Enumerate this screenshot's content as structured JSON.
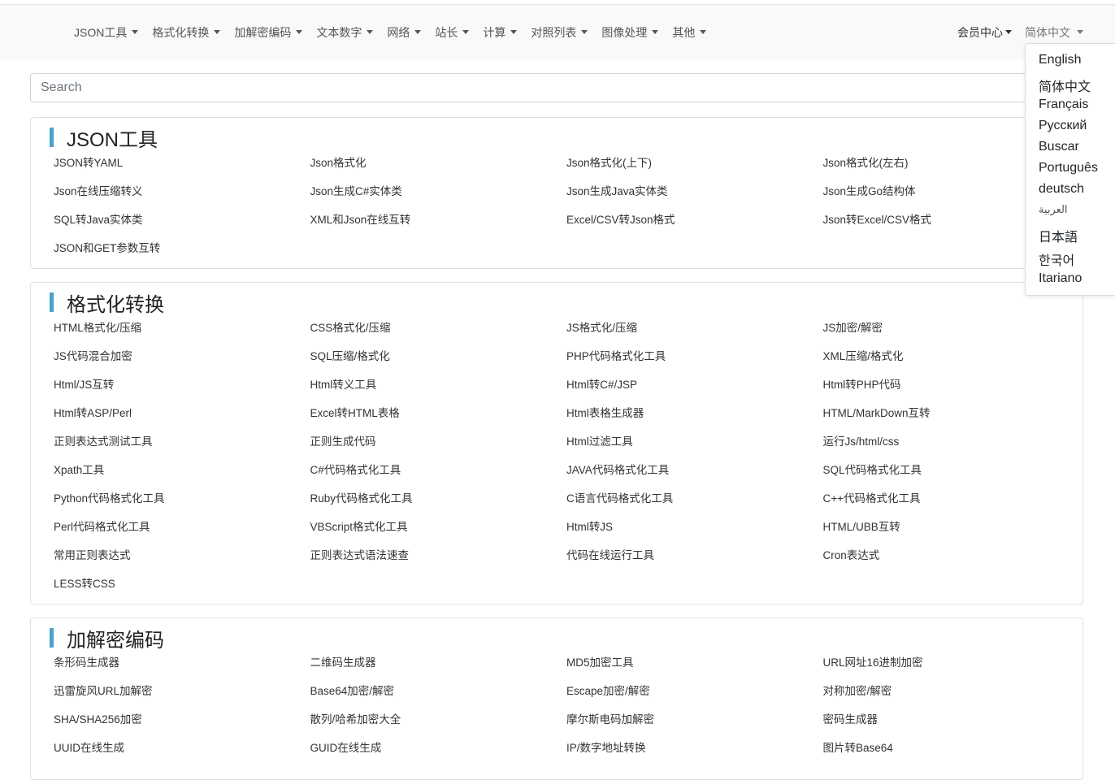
{
  "navbar": {
    "items": [
      {
        "label": "JSON工具"
      },
      {
        "label": "格式化转换"
      },
      {
        "label": "加解密编码"
      },
      {
        "label": "文本数字"
      },
      {
        "label": "网络"
      },
      {
        "label": "站长"
      },
      {
        "label": "计算"
      },
      {
        "label": "对照列表"
      },
      {
        "label": "图像处理"
      },
      {
        "label": "其他"
      }
    ],
    "member_center": "会员中心",
    "language": "简体中文"
  },
  "search": {
    "placeholder": "Search",
    "value": ""
  },
  "sections": [
    {
      "title": "JSON工具",
      "links": [
        "JSON转YAML",
        "Json格式化",
        "Json格式化(上下)",
        "Json格式化(左右)",
        "Json在线压缩转义",
        "Json生成C#实体类",
        "Json生成Java实体类",
        "Json生成Go结构体",
        "SQL转Java实体类",
        "XML和Json在线互转",
        "Excel/CSV转Json格式",
        "Json转Excel/CSV格式",
        "JSON和GET参数互转"
      ]
    },
    {
      "title": "格式化转换",
      "links": [
        "HTML格式化/压缩",
        "CSS格式化/压缩",
        "JS格式化/压缩",
        "JS加密/解密",
        "JS代码混合加密",
        "SQL压缩/格式化",
        "PHP代码格式化工具",
        "XML压缩/格式化",
        "Html/JS互转",
        "Html转义工具",
        "Html转C#/JSP",
        "Html转PHP代码",
        "Html转ASP/Perl",
        "Excel转HTML表格",
        "Html表格生成器",
        "HTML/MarkDown互转",
        "正则表达式测试工具",
        "正则生成代码",
        "Html过滤工具",
        "运行Js/html/css",
        "Xpath工具",
        "C#代码格式化工具",
        "JAVA代码格式化工具",
        "SQL代码格式化工具",
        "Python代码格式化工具",
        "Ruby代码格式化工具",
        "C语言代码格式化工具",
        "C++代码格式化工具",
        "Perl代码格式化工具",
        "VBScript格式化工具",
        "Html转JS",
        "HTML/UBB互转",
        "常用正则表达式",
        "正则表达式语法速查",
        "代码在线运行工具",
        "Cron表达式",
        "LESS转CSS"
      ]
    },
    {
      "title": "加解密编码",
      "links": [
        "条形码生成器",
        "二维码生成器",
        "MD5加密工具",
        "URL网址16进制加密",
        "迅雷旋风URL加解密",
        "Base64加密/解密",
        "Escape加密/解密",
        "对称加密/解密",
        "SHA/SHA256加密",
        "散列/哈希加密大全",
        "摩尔斯电码加解密",
        "密码生成器",
        "UUID在线生成",
        "GUID在线生成",
        "IP/数字地址转换",
        "图片转Base64"
      ]
    }
  ],
  "language_menu": [
    "English",
    "简体中文",
    "Français",
    "Русский",
    "Buscar",
    "Português",
    "deutsch",
    "العربية",
    "日本語",
    "한국어",
    "Itariano"
  ]
}
